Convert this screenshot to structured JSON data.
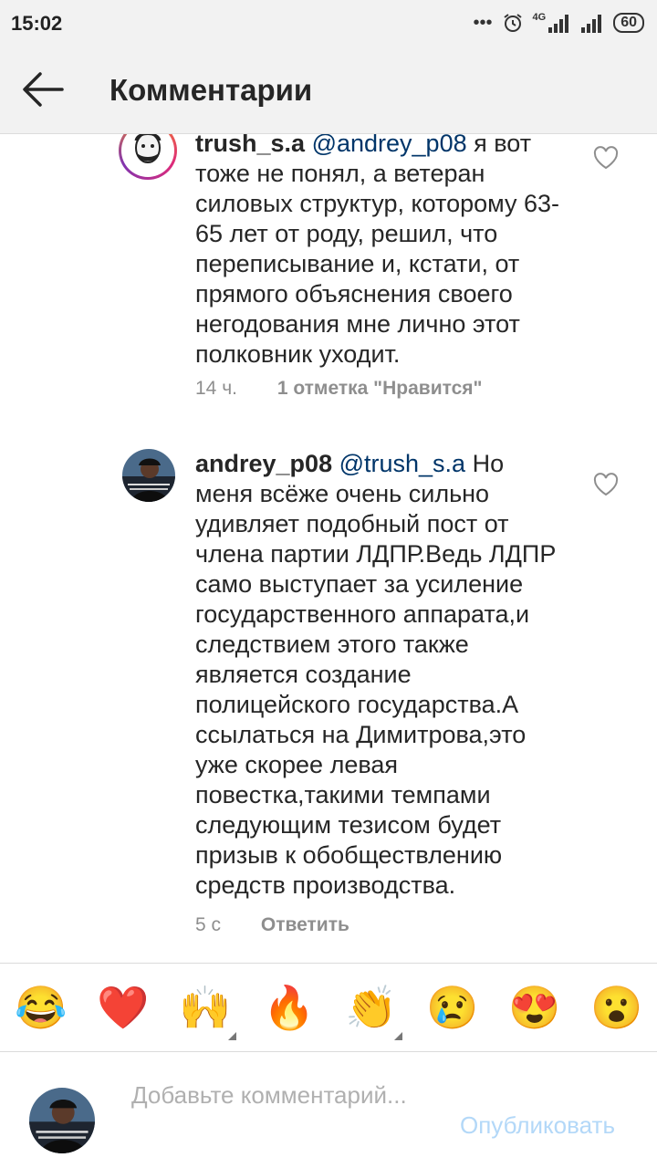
{
  "status": {
    "time": "15:02",
    "signal_label": "4G",
    "battery": "60"
  },
  "header": {
    "title": "Комментарии"
  },
  "comments": [
    {
      "user": "trush_s.a",
      "mention": "@andrey_p08",
      "text": "я вот тоже не понял, а ветеран силовых структур, которому 63-65 лет от роду, решил, что переписывание и, кстати, от прямого объяснения своего негодования мне лично этот полковник уходит.",
      "time": "14 ч.",
      "action": "1 отметка \"Нравится\""
    },
    {
      "user": "andrey_p08",
      "mention": "@trush_s.a",
      "text": "Но меня всёже очень сильно удивляет подобный пост от члена партии ЛДПР.Ведь ЛДПР само выступает за усиление государственного аппарата,и следствием этого также является создание полицейского государства.А ссылаться на Димитрова,это уже скорее левая повестка,такими темпами следующим тезисом будет призыв к обобществлению средств производства.",
      "time": "5 с",
      "action": "Ответить"
    }
  ],
  "emojis": [
    "😂",
    "❤️",
    "🙌",
    "🔥",
    "👏",
    "😢",
    "😍",
    "😮"
  ],
  "composer": {
    "placeholder": "Добавьте комментарий...",
    "publish_label": "Опубликовать"
  },
  "colors": {
    "mention": "#003569",
    "publish_disabled": "#b3d8f8",
    "meta": "#8e8e8e"
  }
}
